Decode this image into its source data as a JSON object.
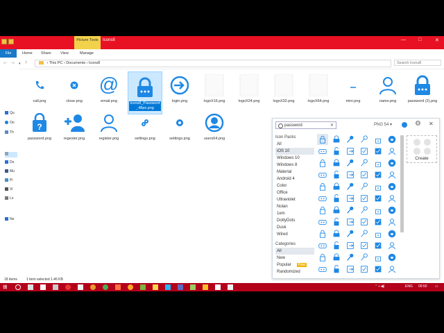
{
  "window": {
    "title": "Icons8",
    "context_tab": "Picture Tools",
    "controls": [
      "—",
      "□",
      "✕"
    ]
  },
  "ribbon": {
    "tabs": [
      "File",
      "Home",
      "Share",
      "View",
      "Manage"
    ]
  },
  "address": {
    "crumbs": [
      "This PC",
      "Documents",
      "Icons8"
    ],
    "search_placeholder": "Search Icons8"
  },
  "navpane": {
    "items": [
      "Qu",
      "On",
      "Th",
      "",
      "Do",
      "Mu",
      "Pi",
      "Vi",
      "Lo",
      "Ne"
    ]
  },
  "files": [
    {
      "name": "call.png",
      "icon": "phone-icon"
    },
    {
      "name": "close.png",
      "icon": "close-icon"
    },
    {
      "name": "email.png",
      "icon": "at-icon"
    },
    {
      "name": "icons8_Password_48px.png",
      "icon": "lock-icon"
    },
    {
      "name": "login.png",
      "icon": "login-icon"
    },
    {
      "name": "logoX16.png",
      "icon": "blank-icon"
    },
    {
      "name": "logoX24.png",
      "icon": "blank-icon"
    },
    {
      "name": "logoX32.png",
      "icon": "blank-icon"
    },
    {
      "name": "logoX64.png",
      "icon": "blank-icon"
    },
    {
      "name": "mini.png",
      "icon": "minimize-icon"
    },
    {
      "name": "name.png",
      "icon": "user-icon"
    },
    {
      "name": "password (2).png",
      "icon": "lock-icon"
    },
    {
      "name": "password.png",
      "icon": "help-shield-icon"
    },
    {
      "name": "regester.png",
      "icon": "add-user-icon"
    },
    {
      "name": "register.png",
      "icon": "user-icon"
    },
    {
      "name": "settings.png",
      "icon": "gears-icon"
    },
    {
      "name": "settings.png",
      "icon": "settings-icon"
    },
    {
      "name": "users64.png",
      "icon": "user-circle-icon"
    }
  ],
  "selected_file_label_lines": [
    "icons8_Password",
    "_48px.png"
  ],
  "status": {
    "items": "18 items",
    "selected": "1 item selected  1.46 KB"
  },
  "icons8_panel": {
    "search_value": "password",
    "clear": "✕",
    "format": "PNG 54",
    "create_label": "Create",
    "icon_packs_header": "Icon Packs",
    "icon_packs": [
      "All",
      "iOS 10",
      "Windows 10",
      "Windows 8",
      "Material",
      "Android 4",
      "Color",
      "Office",
      "Ultraviolet",
      "Nolan",
      "1em",
      "DottyDots",
      "Dusk",
      "Wired"
    ],
    "selected_pack": "iOS 10",
    "categories_header": "Categories",
    "categories": [
      "All",
      "New",
      "Popular",
      "Randomized"
    ],
    "free_badge": "Free",
    "accent_color": "#1e88e5"
  },
  "taskbar": {
    "tray": {
      "lang": "ENG",
      "time": "09:50"
    }
  },
  "colors": {
    "title_bar": "#e81123",
    "taskbar": "#b3001b",
    "selection": "#cce8ff"
  }
}
